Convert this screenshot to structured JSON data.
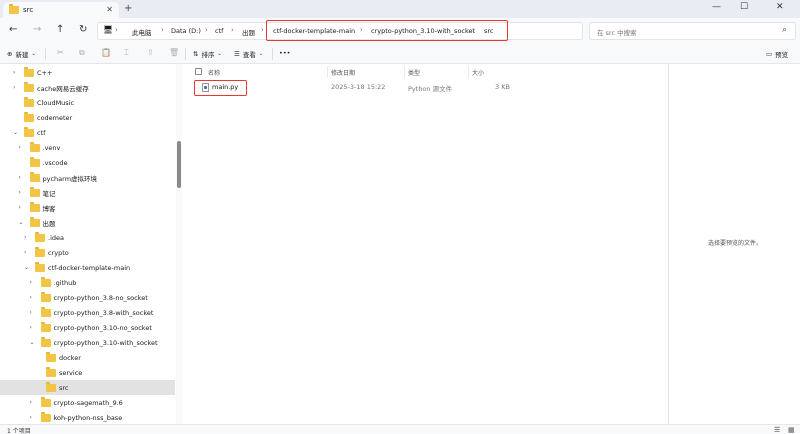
{
  "tab": {
    "title": "src",
    "close": "✕",
    "new": "+"
  },
  "window_controls": {
    "minimize": "—",
    "maximize": "☐",
    "close": "✕"
  },
  "nav": {
    "back": "←",
    "forward": "→",
    "up": "↑",
    "refresh": "↻",
    "breadcrumbs": [
      "此电脑",
      "Data (D:)",
      "ctf",
      "出题",
      "ctf-docker-template-main",
      "crypto-python_3.10-with_socket",
      "src"
    ],
    "separator": "›",
    "search_placeholder": "在 src 中搜索"
  },
  "toolbar": {
    "new_label": "新建",
    "sort_label": "排序",
    "view_label": "查看",
    "more": "•••",
    "details_label": "预览"
  },
  "sidebar": {
    "items": [
      {
        "label": "C++",
        "indent": 1,
        "chevron": "›"
      },
      {
        "label": "cache网易云缓存",
        "indent": 1,
        "chevron": "›"
      },
      {
        "label": "CloudMusic",
        "indent": 1,
        "chevron": ""
      },
      {
        "label": "codemeter",
        "indent": 1,
        "chevron": ""
      },
      {
        "label": "ctf",
        "indent": 1,
        "chevron": "⌄"
      },
      {
        "label": ".venv",
        "indent": 2,
        "chevron": "›"
      },
      {
        "label": ".vscode",
        "indent": 2,
        "chevron": ""
      },
      {
        "label": "pycharm虚拟环境",
        "indent": 2,
        "chevron": "›"
      },
      {
        "label": "笔记",
        "indent": 2,
        "chevron": "›"
      },
      {
        "label": "博客",
        "indent": 2,
        "chevron": "›"
      },
      {
        "label": "出题",
        "indent": 2,
        "chevron": "⌄"
      },
      {
        "label": ".idea",
        "indent": 3,
        "chevron": "›"
      },
      {
        "label": "crypto",
        "indent": 3,
        "chevron": "›"
      },
      {
        "label": "ctf-docker-template-main",
        "indent": 3,
        "chevron": "⌄"
      },
      {
        "label": ".github",
        "indent": 4,
        "chevron": "›"
      },
      {
        "label": "crypto-python_3.8-no_socket",
        "indent": 4,
        "chevron": "›"
      },
      {
        "label": "crypto-python_3.8-with_socket",
        "indent": 4,
        "chevron": "›"
      },
      {
        "label": "crypto-python_3.10-no_socket",
        "indent": 4,
        "chevron": "›"
      },
      {
        "label": "crypto-python_3.10-with_socket",
        "indent": 4,
        "chevron": "⌄"
      },
      {
        "label": "docker",
        "indent": 5,
        "chevron": ""
      },
      {
        "label": "service",
        "indent": 5,
        "chevron": ""
      },
      {
        "label": "src",
        "indent": 5,
        "chevron": "",
        "selected": true
      },
      {
        "label": "crypto-sagemath_9.6",
        "indent": 4,
        "chevron": "›"
      },
      {
        "label": "koh-python-nss_base",
        "indent": 4,
        "chevron": "›"
      }
    ]
  },
  "list": {
    "columns": [
      "名称",
      "修改日期",
      "类型",
      "大小"
    ],
    "files": [
      {
        "name": "main.py",
        "modified": "2025-3-18 15:22",
        "type": "Python 源文件",
        "size": "3 KB"
      }
    ]
  },
  "preview": {
    "message": "选择要预览的文件。"
  },
  "status": {
    "count": "1 个项目"
  },
  "colors": {
    "folder": "#f3c545",
    "highlight": "#e53935",
    "selected": "#e2e2e2"
  }
}
